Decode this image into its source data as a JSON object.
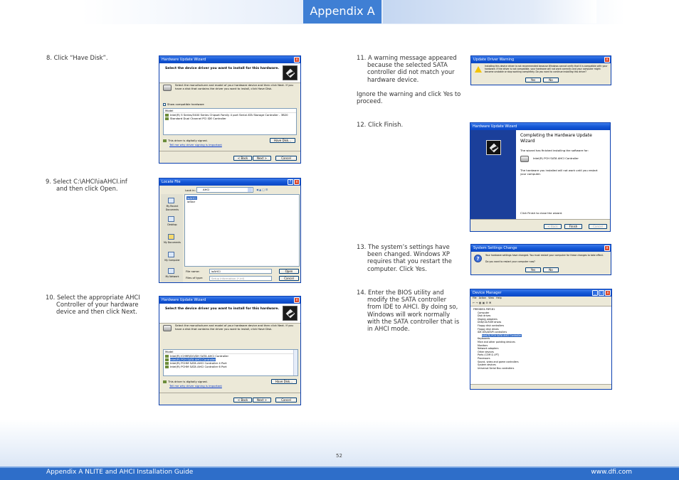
{
  "header": {
    "title": "Appendix A"
  },
  "footer": {
    "left": "Appendix A NLITE and AHCI Installation Guide",
    "right": "www.dfi.com",
    "page_number": "52"
  },
  "steps": {
    "s8": "8. Click “Have Disk”.",
    "s9": "9. Select C:\\AHCI\\iaAHCI.inf and then click Open.",
    "s10": "10. Select the appropriate AHCI Controller of your hardware device and then click Next.",
    "s11": "11. A warning message appeared because the selected SATA controller did not match your hardware device.",
    "s11b": "Ignore the warning and click Yes to proceed.",
    "s12": "12. Click Finish.",
    "s13": "13. The system’s settings have been changed. Windows XP requires that you restart the computer. Click Yes.",
    "s14": "14. Enter the BIOS utility and modify the SATA controller from IDE to AHCI. By doing so, Windows will work normally with the SATA controller that is in AHCI mode."
  },
  "win1": {
    "title": "Hardware Update Wizard",
    "heading": "Select the device driver you want to install for this hardware.",
    "desc": "Select the manufacturer and model of your hardware device and then click Next. If you have a disk that contains the driver you want to install, click Have Disk.",
    "show_compat": "Show compatible hardware",
    "model_label": "Model",
    "models": [
      "Intel(R) 5 Series/3400 Series Chipset Family 4 port Serial ATA Storage Controller - 3B20",
      "Standard Dual Channel PCI IDE Controller"
    ],
    "signed": "This driver is digitally signed.",
    "signing_link": "Tell me why driver signing is important",
    "have_disk": "Have Disk...",
    "back": "< Back",
    "next": "Next >",
    "cancel": "Cancel"
  },
  "win2": {
    "title": "Locate File",
    "look_in_label": "Look in:",
    "look_in_value": "AHCI",
    "files": [
      "iaAHCI",
      "iaStor"
    ],
    "places": [
      "My Recent Documents",
      "Desktop",
      "My Documents",
      "My Computer",
      "My Network"
    ],
    "file_name_label": "File name:",
    "file_name_value": "iaAHCI",
    "file_type_label": "Files of type:",
    "file_type_value": "Setup Information (*.inf)",
    "open": "Open",
    "cancel": "Cancel"
  },
  "win3": {
    "title": "Hardware Update Wizard",
    "heading": "Select the device driver you want to install for this hardware.",
    "desc": "Select the manufacturer and model of your hardware device and then click Next. If you have a disk that contains the driver you want to install, click Have Disk.",
    "model_label": "Model",
    "models": [
      "Intel(R) ICH9R/DO/DH SATA AHCI Controller",
      "Intel(R) PCH SATA AHCI Controller",
      "Intel(R) PCHM SATA AHCI Controller 4 Port",
      "Intel(R) PCHM SATA AHCI Controller 6 Port"
    ],
    "signed": "This driver is digitally signed.",
    "signing_link": "Tell me why driver signing is important",
    "have_disk": "Have Disk...",
    "back": "< Back",
    "next": "Next >",
    "cancel": "Cancel"
  },
  "win4": {
    "title": "Update Driver Warning",
    "message": "Installing this device driver is not recommended because Windows cannot verify that it is compatible with your hardware. If the driver is not compatible, your hardware will not work correctly and your computer might become unstable or stop working completely. Do you want to continue installing this driver?",
    "yes": "Yes",
    "no": "No"
  },
  "win5": {
    "title": "Hardware Update Wizard",
    "heading": "Completing the Hardware Update Wizard",
    "line1": "The wizard has finished installing the software for:",
    "device": "Intel(R) PCH SATA AHCI Controller",
    "line2": "The hardware you installed will not work until you restart your computer.",
    "close_hint": "Click Finish to close the wizard.",
    "back": "< Back",
    "finish": "Finish",
    "cancel": "Cancel"
  },
  "win6": {
    "title": "System Settings Change",
    "message": "Your hardware settings have changed. You must restart your computer for these changes to take effect.",
    "question": "Do you want to restart your computer now?",
    "yes": "Yes",
    "no": "No"
  },
  "win7": {
    "title": "Device Manager",
    "menu": [
      "File",
      "Action",
      "View",
      "Help"
    ],
    "tree": [
      "FREDDIE4-FBF1B1",
      "Computer",
      "Disk drives",
      "Display adapters",
      "DVD/CD-ROM drives",
      "Floppy disk controllers",
      "Floppy disk drives",
      "IDE ATA/ATAPI controllers",
      "Intel(R) PCH SATA AHCI Controller",
      "Keyboards",
      "Mice and other pointing devices",
      "Monitors",
      "Network adapters",
      "Other devices",
      "Ports (COM & LPT)",
      "Processors",
      "Sound, video and game controllers",
      "System devices",
      "Universal Serial Bus controllers"
    ]
  },
  "colors": {
    "header_blue": "#3f7fd4",
    "footer_blue": "#2e6ec9",
    "xp_title": "#0b47c4"
  }
}
